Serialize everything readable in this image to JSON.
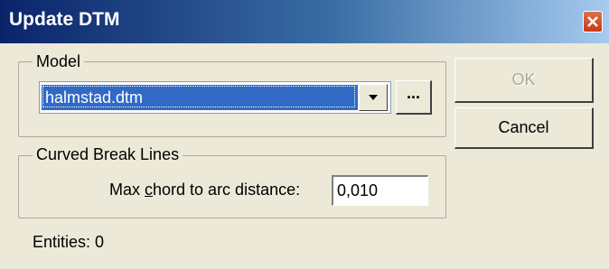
{
  "window": {
    "title": "Update DTM"
  },
  "model_group": {
    "label": "Model",
    "selected_value": "halmstad.dtm",
    "browse_label": "..."
  },
  "buttons": {
    "ok": "OK",
    "cancel": "Cancel"
  },
  "curved_group": {
    "label": "Curved Break Lines",
    "field_label_pre": "Max ",
    "field_label_accel": "c",
    "field_label_post": "hord to arc distance:",
    "value": "0,010"
  },
  "status": {
    "entities": "Entities: 0"
  },
  "colors": {
    "title_bar": "#0a246a",
    "selection": "#316ac5",
    "dialog_bg": "#ece9d8"
  }
}
